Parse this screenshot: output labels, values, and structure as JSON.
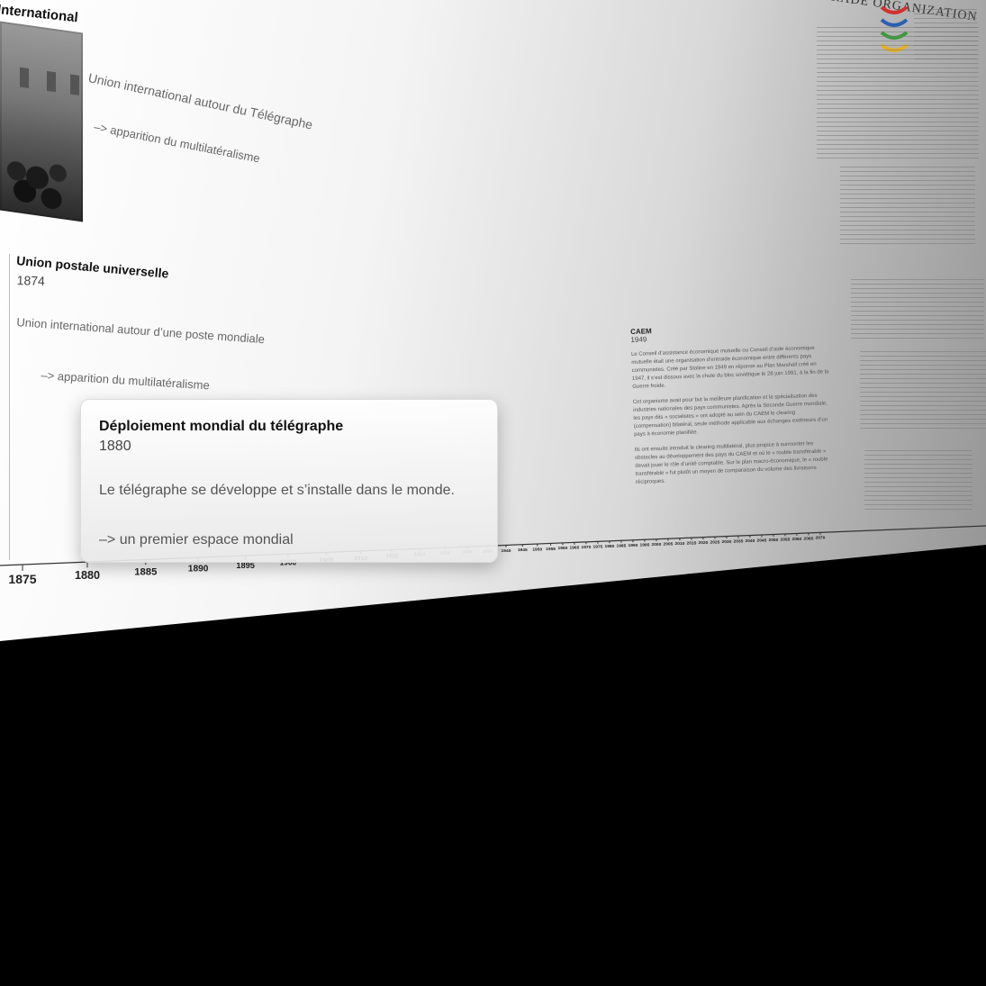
{
  "events": {
    "telegraph_union": {
      "title": "International",
      "description": "Union international autour du Télégraphe",
      "note": "–> apparition du multilatéralisme"
    },
    "upu": {
      "title": "Union postale universelle",
      "year": "1874",
      "description": "Union international autour d’une poste mondiale",
      "note": "–> apparition du multilatéralisme"
    },
    "selected_card": {
      "title": "Déploiement mondial du télégraphe",
      "year": "1880",
      "description": "Le télégraphe se développe et s’installe dans le monde.",
      "note": "–> un premier espace mondial"
    },
    "caem": {
      "title": "CAEM",
      "year": "1949",
      "paragraph_1": "Le Conseil d’assistance économique mutuelle ou Conseil d’aide économique mutuelle était une organisation d’entraide économique entre différents pays communistes. Créé par Staline en 1949 en réponse au Plan Marshall créé en 1947, il s’est dissous avec la chute du bloc soviétique le 28 juin 1991, à la fin de la Guerre froide.",
      "paragraph_2": "Cet organisme avait pour but la meilleure planification et la spécialisation des industries nationales des pays communistes. Après la Seconde Guerre mondiale, les pays dits « socialistes » ont adopté au sein du CAEM le clearing (compensation) bilatéral, seule méthode applicable aux échanges extérieurs d’un pays à économie planifiée.",
      "paragraph_3": "Ils ont ensuite introduit le clearing multilatéral, plus propice à surmonter les obstacles au développement des pays du CAEM et où le « rouble transférable » devait jouer le rôle d’unité comptable. Sur le plan macro-économique, le « rouble transférable » fut plutôt un moyen de comparaison du volume des livraisons réciproques."
    },
    "wto": {
      "logo_text": "TRADE ORGANIZATION"
    }
  },
  "timeline": {
    "ticks": [
      "1875",
      "1880",
      "1885",
      "1890",
      "1895",
      "1900",
      "1905",
      "1910",
      "1915",
      "1920",
      "1925",
      "1930",
      "1935",
      "1940",
      "1945",
      "1950",
      "1955",
      "1960",
      "1965",
      "1970",
      "1975",
      "1980",
      "1985",
      "1990",
      "1995",
      "2000",
      "2005",
      "2010",
      "2015",
      "2020",
      "2025",
      "2030",
      "2035",
      "2040",
      "2045",
      "2050",
      "2055",
      "2060",
      "2065",
      "2070"
    ]
  },
  "colors": {
    "background": "#000000",
    "sheet_light": "#ffffff",
    "sheet_dark": "#8a8a8a",
    "text_dark": "#111111",
    "text_muted": "#666666",
    "wto_red": "#d3302f",
    "wto_blue": "#2a5fb0",
    "wto_green": "#3a9a3a",
    "wto_yellow": "#e6b020"
  }
}
